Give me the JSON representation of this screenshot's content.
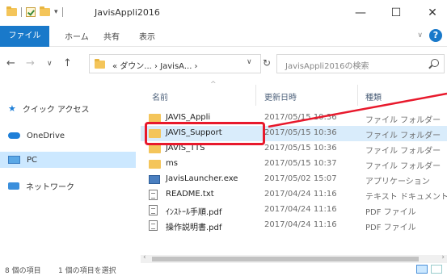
{
  "window": {
    "title": "JavisAppli2016",
    "minimize": "—",
    "maximize": "☐",
    "close": "✕"
  },
  "ribbon": {
    "tabs": [
      "ファイル",
      "ホーム",
      "共有",
      "表示"
    ],
    "help": "?"
  },
  "address": {
    "path": "« ダウン... › JavisA... ›",
    "search_placeholder": "JavisAppli2016の検索"
  },
  "navpane": {
    "items": [
      {
        "label": "クイック アクセス",
        "icon": "star-icon"
      },
      {
        "label": "OneDrive",
        "icon": "cloud-icon"
      },
      {
        "label": "PC",
        "icon": "pc-icon",
        "selected": true
      },
      {
        "label": "ネットワーク",
        "icon": "network-icon"
      }
    ]
  },
  "columns": {
    "name": "名前",
    "date": "更新日時",
    "type": "種類"
  },
  "files": [
    {
      "name": "JAVIS_Appli",
      "date": "2017/05/15 10:36",
      "type": "ファイル フォルダー",
      "icon": "folder"
    },
    {
      "name": "JAVIS_Support",
      "date": "2017/05/15 10:36",
      "type": "ファイル フォルダー",
      "icon": "folder"
    },
    {
      "name": "JAVIS_TTS",
      "date": "2017/05/15 10:36",
      "type": "ファイル フォルダー",
      "icon": "folder"
    },
    {
      "name": "ms",
      "date": "2017/05/15 10:37",
      "type": "ファイル フォルダー",
      "icon": "folder"
    },
    {
      "name": "JavisLauncher.exe",
      "date": "2017/05/02 15:07",
      "type": "アプリケーション",
      "icon": "exe"
    },
    {
      "name": "README.txt",
      "date": "2017/04/24 11:16",
      "type": "テキスト ドキュメント",
      "icon": "doc"
    },
    {
      "name": "ｲﾝｽﾄｰﾙ手順.pdf",
      "date": "2017/04/24 11:16",
      "type": "PDF ファイル",
      "icon": "doc"
    },
    {
      "name": "操作説明書.pdf",
      "date": "2017/04/24 11:16",
      "type": "PDF ファイル",
      "icon": "doc"
    }
  ],
  "status": {
    "item_count": "8 個の項目",
    "selected_count": "1 個の項目を選択"
  },
  "colors": {
    "accent": "#1979ca",
    "highlight": "#e8192c",
    "selection": "#cce8ff"
  }
}
